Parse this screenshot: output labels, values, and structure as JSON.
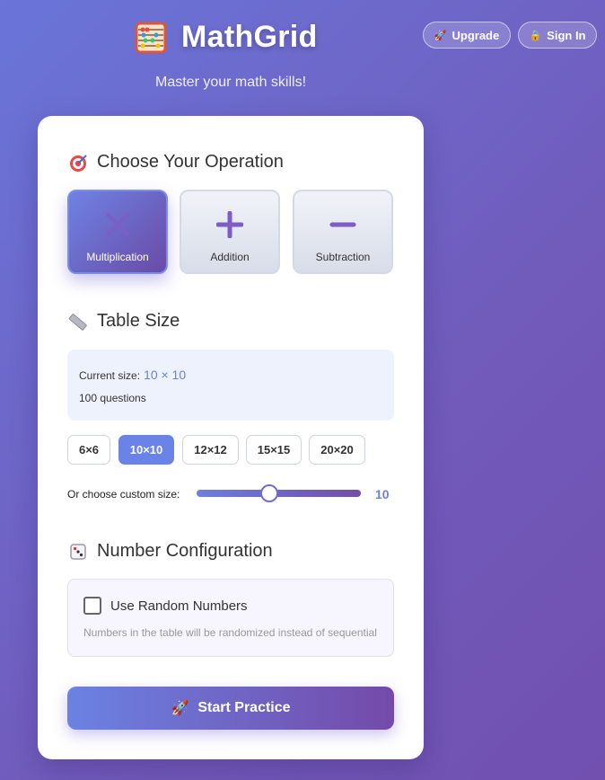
{
  "header": {
    "title": "MathGrid",
    "tagline": "Master your math skills!",
    "upgrade_label": "Upgrade",
    "signin_label": "Sign In"
  },
  "operation": {
    "title": "Choose Your Operation",
    "options": [
      {
        "label": "Multiplication",
        "active": true
      },
      {
        "label": "Addition",
        "active": false
      },
      {
        "label": "Subtraction",
        "active": false
      }
    ]
  },
  "table_size": {
    "title": "Table Size",
    "current_label": "Current size:",
    "current_value": "10 × 10",
    "questions": "100 questions",
    "presets": [
      "6×6",
      "10×10",
      "12×12",
      "15×15",
      "20×20"
    ],
    "selected_preset": "10×10",
    "custom_label": "Or choose custom size:",
    "slider_value": "10"
  },
  "number_config": {
    "title": "Number Configuration",
    "random_label": "Use Random Numbers",
    "random_checked": false,
    "random_desc": "Numbers in the table will be randomized instead of sequential"
  },
  "start_label": "Start Practice",
  "colors": {
    "accent": "#6983e6",
    "accent_dark": "#744aa9"
  },
  "icons": {
    "logo": "abacus-icon",
    "upgrade": "rocket-icon",
    "signin": "lock-icon",
    "operation": "target-icon",
    "size": "ruler-icon",
    "config": "dice-icon",
    "start": "rocket-icon"
  }
}
